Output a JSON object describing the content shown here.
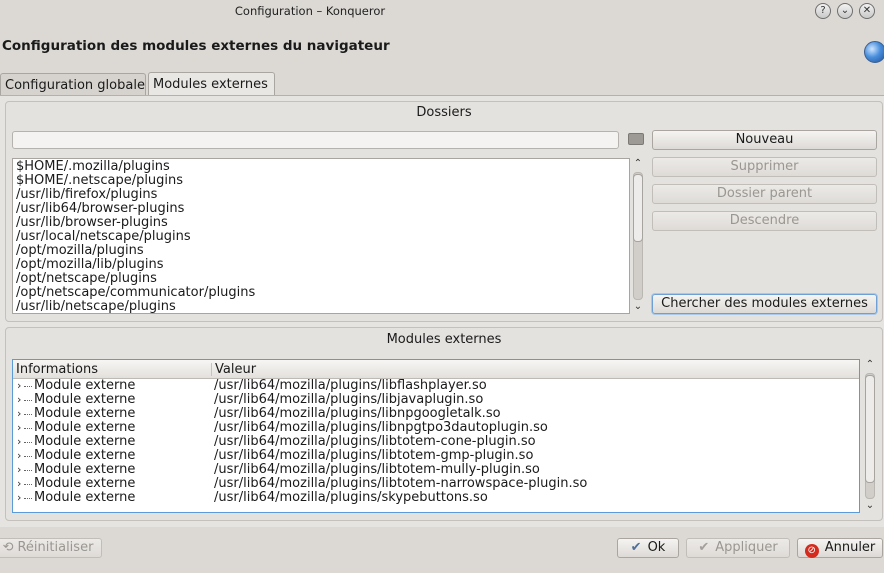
{
  "window": {
    "title": "Configuration – Konqueror",
    "controls": [
      "?",
      "⌄",
      "✕"
    ]
  },
  "header": {
    "title": "Configuration des modules externes du navigateur"
  },
  "tabs": [
    {
      "label": "Configuration globale",
      "active": false
    },
    {
      "label": "Modules externes",
      "active": true
    }
  ],
  "folders": {
    "title": "Dossiers",
    "path_value": "",
    "items": [
      "$HOME/.mozilla/plugins",
      "$HOME/.netscape/plugins",
      "/usr/lib/firefox/plugins",
      "/usr/lib64/browser-plugins",
      "/usr/lib/browser-plugins",
      "/usr/local/netscape/plugins",
      "/opt/mozilla/plugins",
      "/opt/mozilla/lib/plugins",
      "/opt/netscape/plugins",
      "/opt/netscape/communicator/plugins",
      "/usr/lib/netscape/plugins"
    ],
    "buttons": {
      "new": "Nouveau",
      "remove": "Supprimer",
      "parent": "Dossier parent",
      "down": "Descendre",
      "scan": "Chercher des modules externes"
    }
  },
  "plugins": {
    "title": "Modules externes",
    "columns": [
      "Informations",
      "Valeur"
    ],
    "rows": [
      {
        "info": "Module externe",
        "value": "/usr/lib64/mozilla/plugins/libflashplayer.so"
      },
      {
        "info": "Module externe",
        "value": "/usr/lib64/mozilla/plugins/libjavaplugin.so"
      },
      {
        "info": "Module externe",
        "value": "/usr/lib64/mozilla/plugins/libnpgoogletalk.so"
      },
      {
        "info": "Module externe",
        "value": "/usr/lib64/mozilla/plugins/libnpgtpo3dautoplugin.so"
      },
      {
        "info": "Module externe",
        "value": "/usr/lib64/mozilla/plugins/libtotem-cone-plugin.so"
      },
      {
        "info": "Module externe",
        "value": "/usr/lib64/mozilla/plugins/libtotem-gmp-plugin.so"
      },
      {
        "info": "Module externe",
        "value": "/usr/lib64/mozilla/plugins/libtotem-mully-plugin.so"
      },
      {
        "info": "Module externe",
        "value": "/usr/lib64/mozilla/plugins/libtotem-narrowspace-plugin.so"
      },
      {
        "info": "Module externe",
        "value": "/usr/lib64/mozilla/plugins/skypebuttons.so"
      }
    ]
  },
  "footer": {
    "reset": "Réinitialiser",
    "ok": "Ok",
    "apply": "Appliquer",
    "cancel": "Annuler"
  }
}
